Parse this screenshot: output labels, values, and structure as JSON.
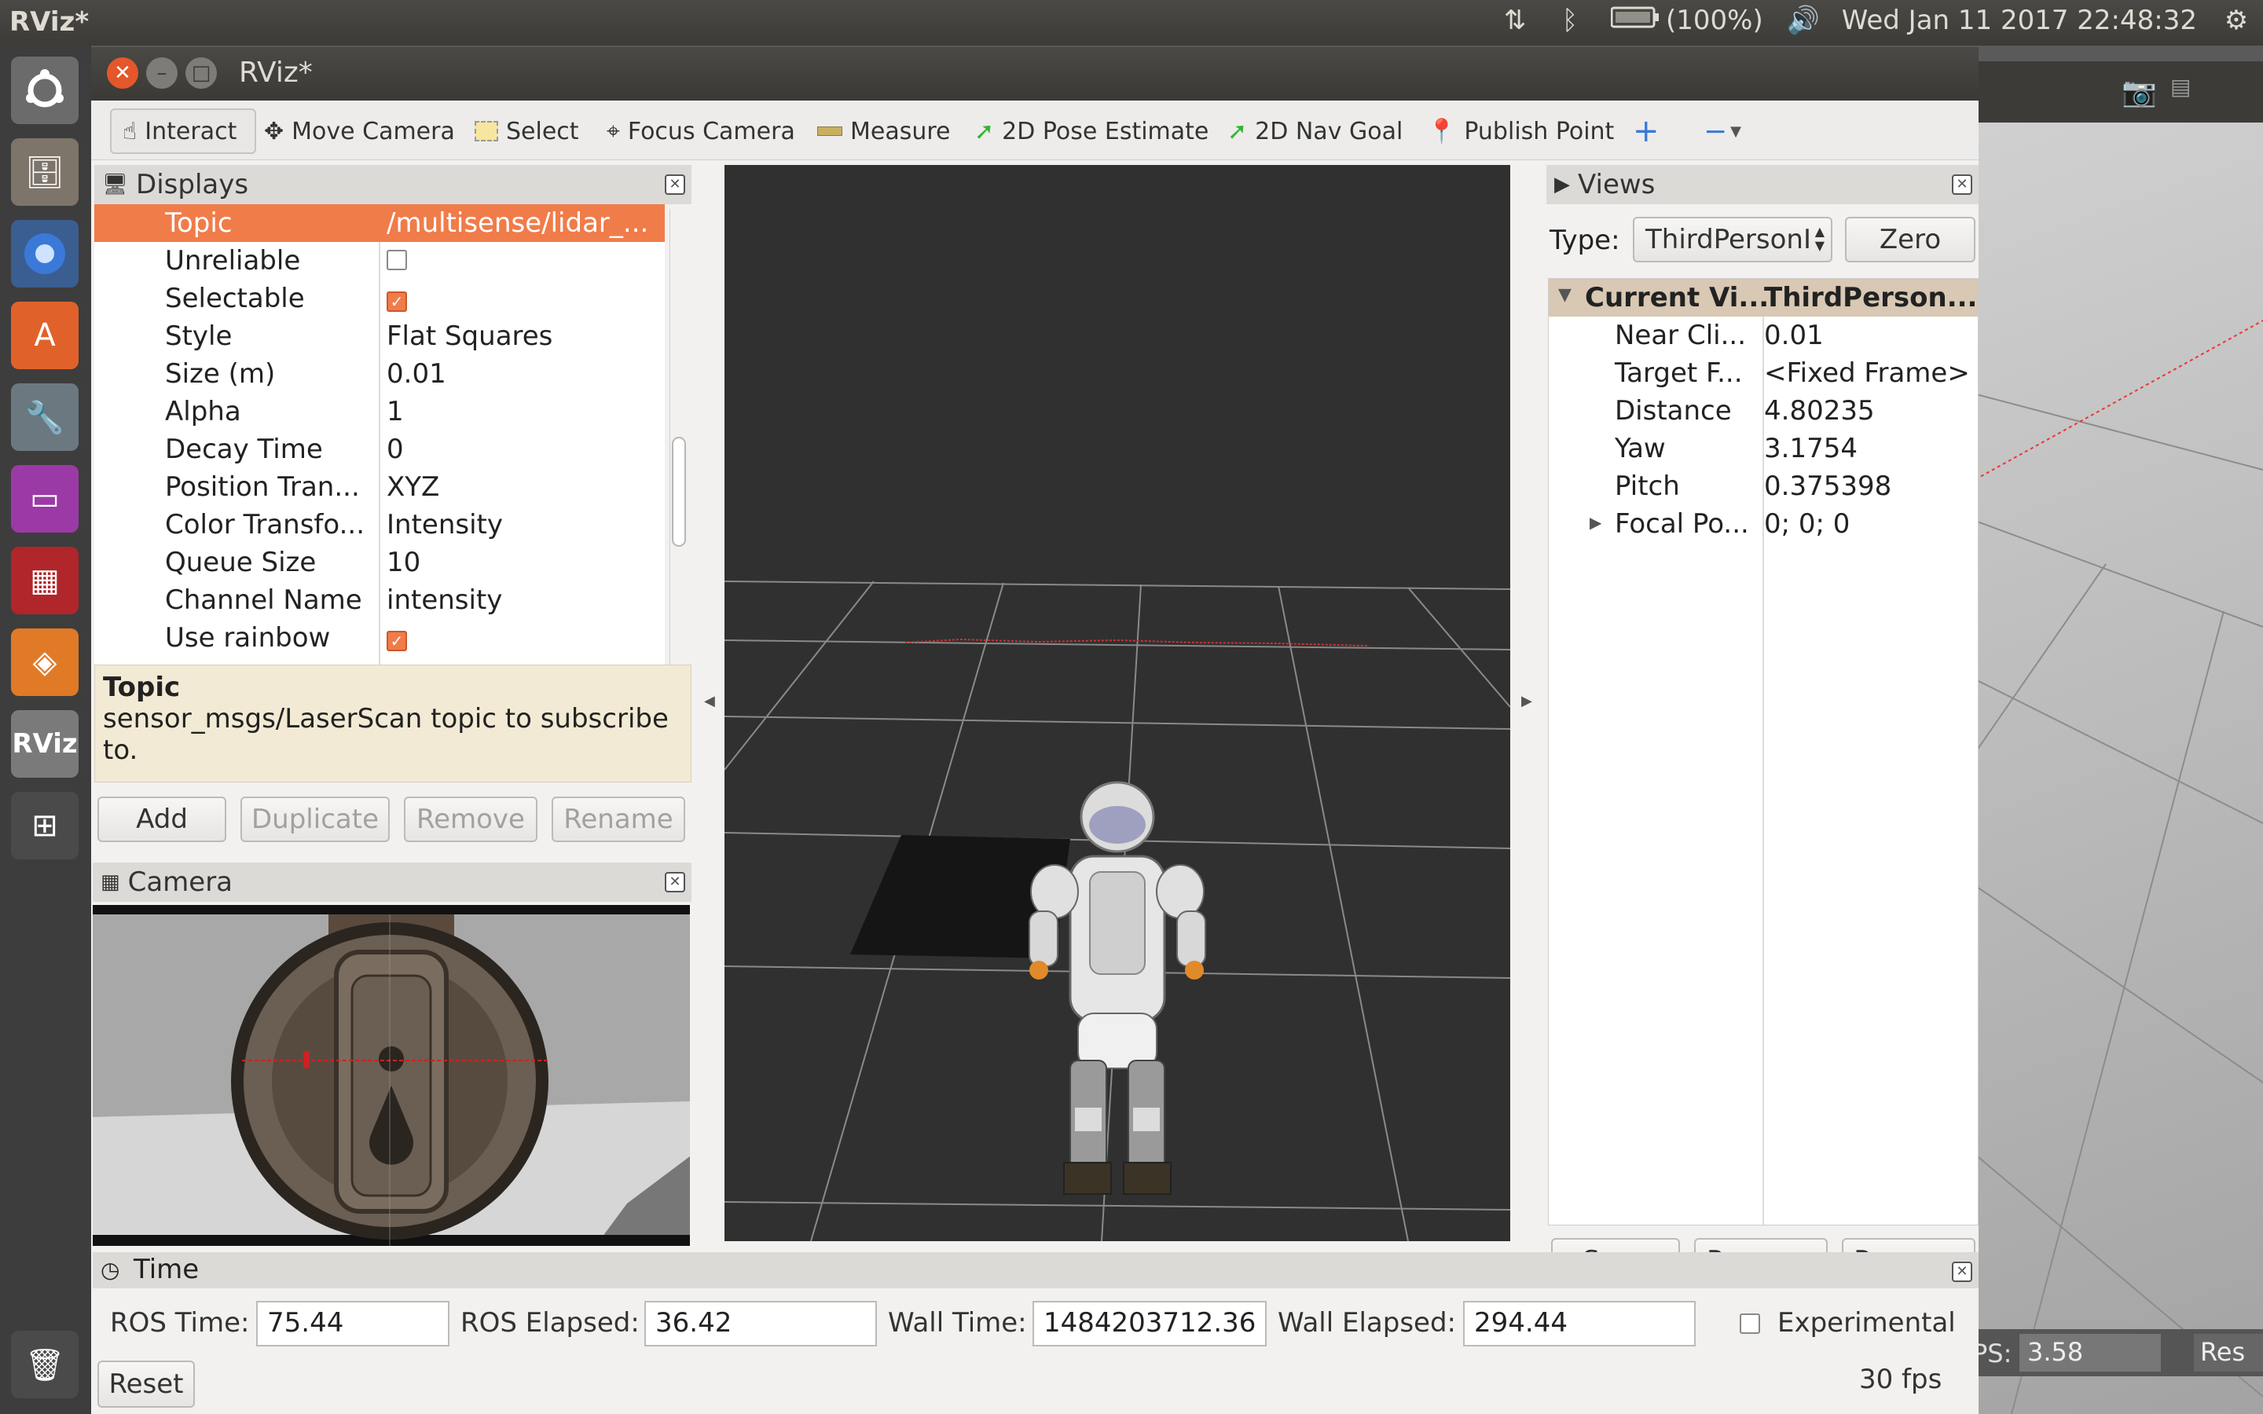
{
  "top_panel": {
    "app_title": "RViz*",
    "battery": "(100%)",
    "datetime": "Wed Jan 11 2017 22:48:32",
    "icons": [
      "network-icon",
      "bluetooth-icon",
      "battery-icon",
      "volume-icon",
      "gear-icon"
    ]
  },
  "launcher": {
    "rviz_label": "RViz",
    "items": [
      "ubuntu-logo-icon",
      "files-icon",
      "chromium-icon",
      "software-center-icon",
      "settings-icon",
      "workspace-icon",
      "presentation-icon",
      "blender-icon",
      "rviz-icon",
      "workspace-switcher-icon",
      "trash-icon"
    ]
  },
  "window": {
    "title": "RViz*"
  },
  "toolbar": {
    "tools": [
      "Interact",
      "Move Camera",
      "Select",
      "Focus Camera",
      "Measure",
      "2D Pose Estimate",
      "2D Nav Goal",
      "Publish Point"
    ]
  },
  "displays": {
    "title": "Displays",
    "properties": [
      {
        "name": "Topic",
        "value": "/multisense/lidar_..."
      },
      {
        "name": "Unreliable",
        "value": ""
      },
      {
        "name": "Selectable",
        "value": ""
      },
      {
        "name": "Style",
        "value": "Flat Squares"
      },
      {
        "name": "Size (m)",
        "value": "0.01"
      },
      {
        "name": "Alpha",
        "value": "1"
      },
      {
        "name": "Decay Time",
        "value": "0"
      },
      {
        "name": "Position Tran...",
        "value": "XYZ"
      },
      {
        "name": "Color Transfo...",
        "value": "Intensity"
      },
      {
        "name": "Queue Size",
        "value": "10"
      },
      {
        "name": "Channel Name",
        "value": "intensity"
      },
      {
        "name": "Use rainbow",
        "value": ""
      }
    ],
    "checkboxes": {
      "unreliable": false,
      "selectable": true,
      "use_rainbow": true
    },
    "description_title": "Topic",
    "description_text": "sensor_msgs/LaserScan topic to subscribe to.",
    "buttons": {
      "add": "Add",
      "duplicate": "Duplicate",
      "remove": "Remove",
      "rename": "Rename"
    }
  },
  "camera": {
    "title": "Camera"
  },
  "views": {
    "title": "Views",
    "type_label": "Type:",
    "type_value": "ThirdPersonI",
    "zero_label": "Zero",
    "header": {
      "name": "Current Vi...",
      "value": "ThirdPerson..."
    },
    "rows": [
      {
        "name": "Near Cli...",
        "value": "0.01"
      },
      {
        "name": "Target F...",
        "value": "<Fixed Frame>"
      },
      {
        "name": "Distance",
        "value": "4.80235"
      },
      {
        "name": "Yaw",
        "value": "3.1754"
      },
      {
        "name": "Pitch",
        "value": "0.375398"
      },
      {
        "name": "Focal Po...",
        "value": "0; 0; 0"
      }
    ],
    "buttons": {
      "save": "Save",
      "remove": "Remove",
      "rename": "Rename"
    }
  },
  "time": {
    "title": "Time",
    "ros_time_label": "ROS Time:",
    "ros_time": "75.44",
    "ros_elapsed_label": "ROS Elapsed:",
    "ros_elapsed": "36.42",
    "wall_time_label": "Wall Time:",
    "wall_time": "1484203712.36",
    "wall_elapsed_label": "Wall Elapsed:",
    "wall_elapsed": "294.44",
    "experimental_label": "Experimental",
    "reset_label": "Reset",
    "fps": "30 fps"
  },
  "background_window": {
    "fps_label": "PS:",
    "fps_value": "3.58",
    "reset_label": "Res"
  }
}
